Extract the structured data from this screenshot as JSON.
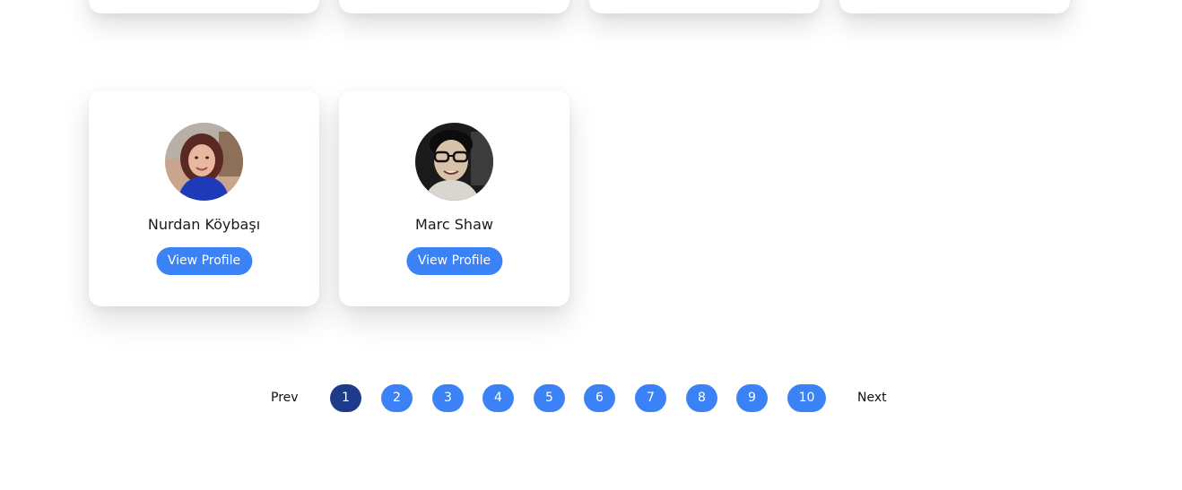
{
  "cards": [
    {
      "name": "Nurdan Köybaşı",
      "button": "View Profile"
    },
    {
      "name": "Marc Shaw",
      "button": "View Profile"
    }
  ],
  "pagination": {
    "prev": "Prev",
    "next": "Next",
    "pages": [
      "1",
      "2",
      "3",
      "4",
      "5",
      "6",
      "7",
      "8",
      "9",
      "10"
    ],
    "current": "1"
  },
  "colors": {
    "button": "#3b82f6",
    "active_page": "#1e3a8a"
  }
}
